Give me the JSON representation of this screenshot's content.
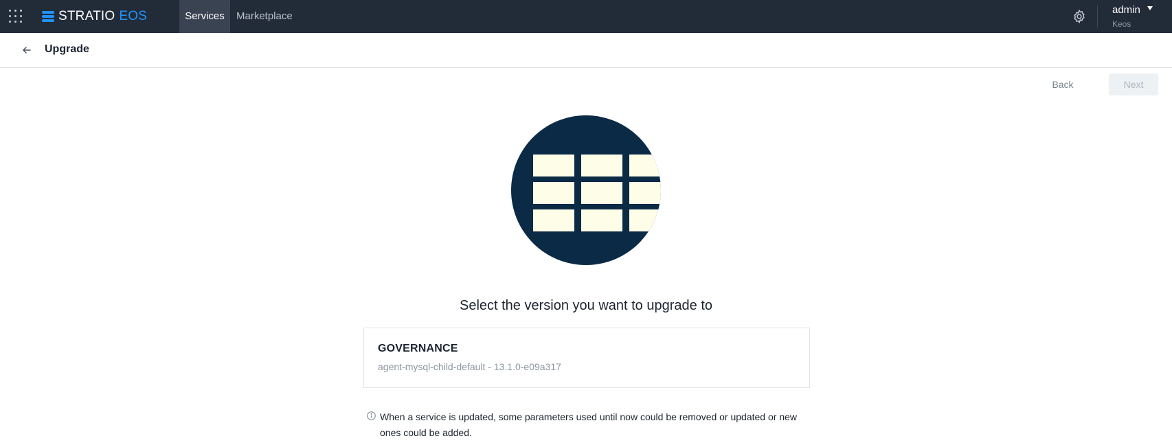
{
  "topbar": {
    "brand_primary": "STRATIO",
    "brand_secondary": "EOS",
    "nav": [
      {
        "label": "Services",
        "active": true
      },
      {
        "label": "Marketplace",
        "active": false
      }
    ],
    "settings_icon": "gear-icon",
    "user": {
      "name": "admin",
      "tenant": "Keos"
    }
  },
  "header": {
    "back_icon": "arrow-left-icon",
    "title": "Upgrade"
  },
  "actions": {
    "back_label": "Back",
    "next_label": "Next",
    "next_disabled": true
  },
  "illustration": "table-grid-icon",
  "prompt": "Select the version you want to upgrade to",
  "version": {
    "name": "GOVERNANCE",
    "detail": "agent-mysql-child-default - 13.1.0-e09a317"
  },
  "note": "When a service is updated, some parameters used until now could be removed or updated or new ones could be added.",
  "colors": {
    "topbar_bg": "#222b38",
    "active_tab_bg": "#3a4352",
    "brand_accent": "#1f93ff",
    "illustration_bg": "#0b2a46",
    "illustration_cells": "#fefde8"
  }
}
